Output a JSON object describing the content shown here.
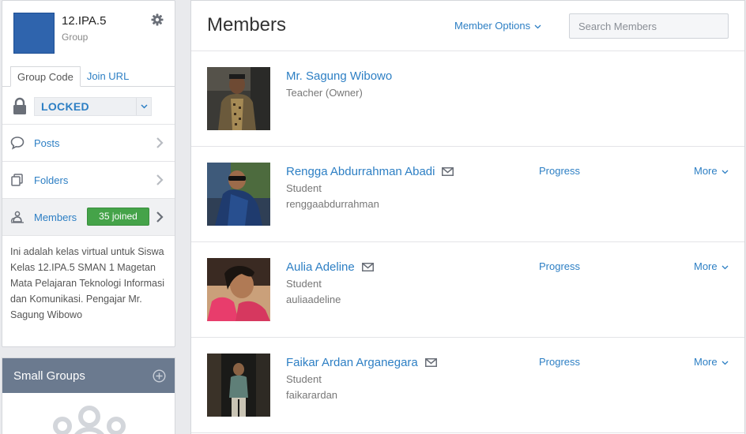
{
  "group": {
    "name": "12.IPA.5",
    "type": "Group",
    "avatar_color": "#2f64ad",
    "tabs": [
      "Group Code",
      "Join URL"
    ],
    "lock_status": "LOCKED",
    "nav": [
      {
        "label": "Posts",
        "icon": "speech-bubble-icon"
      },
      {
        "label": "Folders",
        "icon": "folders-icon"
      },
      {
        "label": "Members",
        "icon": "members-icon",
        "badge": "35 joined"
      }
    ],
    "description": "Ini adalah kelas virtual untuk Siswa Kelas 12.IPA.5 SMAN 1 Magetan Mata Pelajaran Teknologi Informasi dan Komunikasi. Pengajar Mr. Sagung Wibowo"
  },
  "small_groups": {
    "title": "Small Groups"
  },
  "main": {
    "title": "Members",
    "options_label": "Member Options",
    "search_placeholder": "Search Members",
    "members": [
      {
        "name": "Mr. Sagung Wibowo",
        "role": "Teacher (Owner)",
        "username": "",
        "has_mail": false,
        "progress": "",
        "more": ""
      },
      {
        "name": "Rengga Abdurrahman Abadi",
        "role": "Student",
        "username": "renggaabdurrahman",
        "has_mail": true,
        "progress": "Progress",
        "more": "More"
      },
      {
        "name": "Aulia Adeline",
        "role": "Student",
        "username": "auliaadeline",
        "has_mail": true,
        "progress": "Progress",
        "more": "More"
      },
      {
        "name": "Faikar Ardan Arganegara",
        "role": "Student",
        "username": "faikarardan",
        "has_mail": true,
        "progress": "Progress",
        "more": "More"
      }
    ]
  },
  "colors": {
    "accent": "#2d7fc4",
    "badge_green": "#45a349",
    "small_groups_header": "#6b7a8f",
    "page_background": "#e9eaed"
  }
}
